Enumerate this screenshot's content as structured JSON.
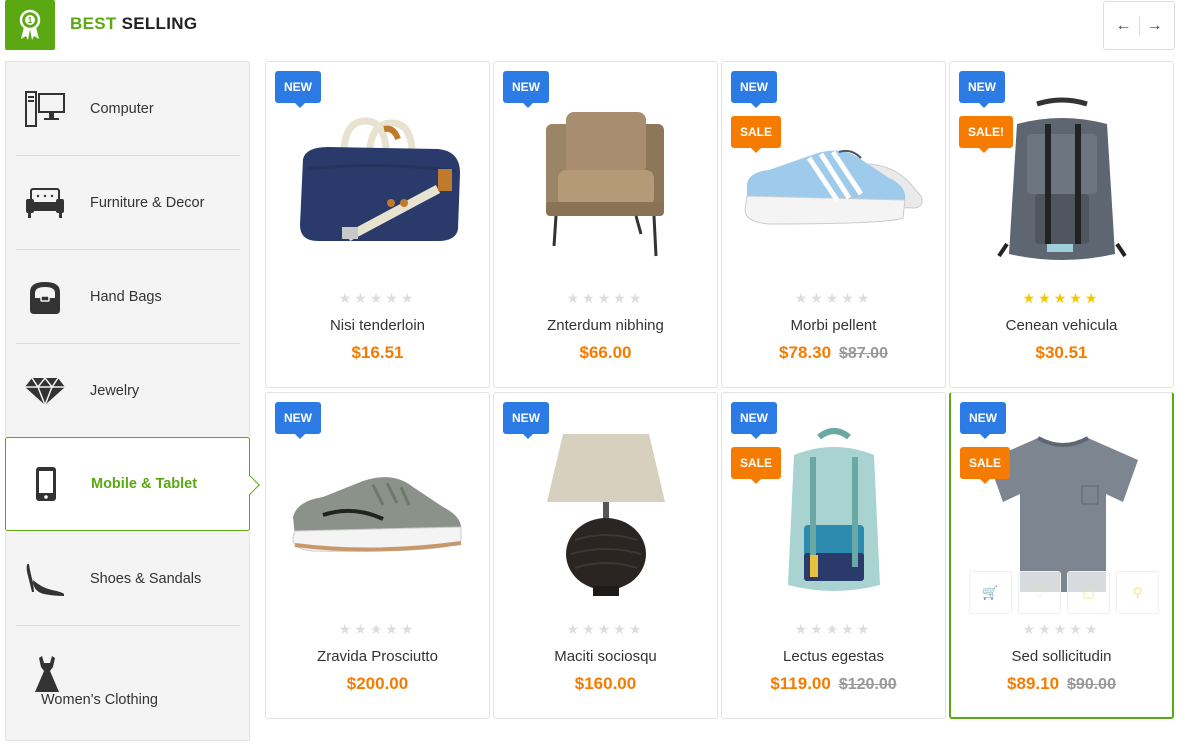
{
  "header": {
    "title_green": "BEST",
    "title_dark": "SELLING",
    "prev_label": "←",
    "next_label": "→"
  },
  "sidebar": {
    "items": [
      {
        "label": "Computer",
        "icon": "computer-icon"
      },
      {
        "label": "Furniture & Decor",
        "icon": "sofa-icon"
      },
      {
        "label": "Hand Bags",
        "icon": "handbag-icon"
      },
      {
        "label": "Jewelry",
        "icon": "diamond-icon"
      },
      {
        "label": "Mobile & Tablet",
        "icon": "mobile-icon",
        "active": true
      },
      {
        "label": "Shoes & Sandals",
        "icon": "high-heel-icon"
      },
      {
        "label": "Women's Clothing",
        "icon": "dress-icon"
      }
    ]
  },
  "products": [
    {
      "name": "Nisi tenderloin",
      "price": "$16.51",
      "old_price": "",
      "tags": [
        "NEW"
      ],
      "rating": 0
    },
    {
      "name": "Znterdum nibhing",
      "price": "$66.00",
      "old_price": "",
      "tags": [
        "NEW"
      ],
      "rating": 0
    },
    {
      "name": "Morbi pellent",
      "price": "$78.30",
      "old_price": "$87.00",
      "tags": [
        "NEW",
        "SALE"
      ],
      "rating": 0
    },
    {
      "name": "Cenean vehicula",
      "price": "$30.51",
      "old_price": "",
      "tags": [
        "NEW",
        "SALE!"
      ],
      "rating": 5
    },
    {
      "name": "Zravida Prosciutto",
      "price": "$200.00",
      "old_price": "",
      "tags": [
        "NEW"
      ],
      "rating": 0
    },
    {
      "name": "Maciti sociosqu",
      "price": "$160.00",
      "old_price": "",
      "tags": [
        "NEW"
      ],
      "rating": 0
    },
    {
      "name": "Lectus egestas",
      "price": "$119.00",
      "old_price": "$120.00",
      "tags": [
        "NEW",
        "SALE"
      ],
      "rating": 0
    },
    {
      "name": "Sed sollicitudin",
      "price": "$89.10",
      "old_price": "$90.00",
      "tags": [
        "NEW",
        "SALE"
      ],
      "rating": 0
    }
  ],
  "colors": {
    "accent": "#5aa812",
    "new_tag": "#2c7be5",
    "sale_tag": "#f57c00",
    "price": "#f57c00",
    "star_active": "#f7c600"
  }
}
